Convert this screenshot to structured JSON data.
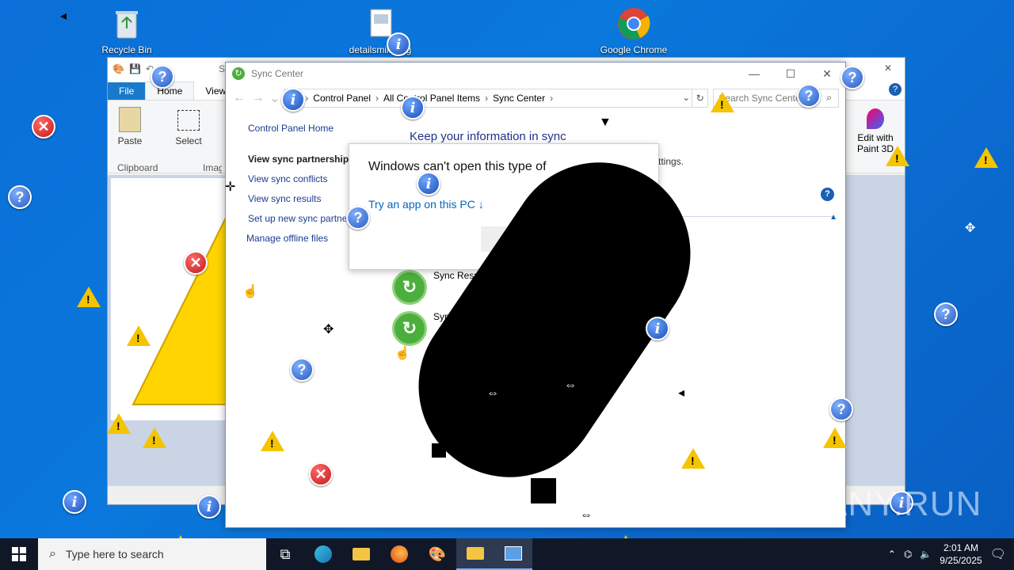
{
  "desktop": {
    "icons": [
      {
        "name": "recycle-bin",
        "label": "Recycle Bin"
      },
      {
        "name": "details",
        "label": "detailsmilla.jpg"
      },
      {
        "name": "chrome",
        "label": "Google Chrome"
      }
    ]
  },
  "paint": {
    "quick_save_title": "Sec",
    "tabs": [
      "File",
      "Home",
      "View"
    ],
    "groups": {
      "clipboard": "Clipboard",
      "paste": "Paste",
      "image": "Image",
      "select": "Select"
    },
    "edit_3d": "Edit with Paint 3D"
  },
  "sync_center": {
    "title": "Sync Center",
    "breadcrumb": [
      "Control Panel",
      "All Control Panel Items",
      "Sync Center"
    ],
    "search_placeholder": "Search Sync Center",
    "nav": {
      "home": "Control Panel Home",
      "items": [
        "View sync partnerships",
        "View sync conflicts",
        "View sync results",
        "Set up new sync partnerships",
        "Manage offline files"
      ]
    },
    "heading": "Keep your information in sync",
    "subtext_tail": "ttings.",
    "items": [
      {
        "label": "Sync Results"
      },
      {
        "label": "Sync"
      }
    ]
  },
  "popup": {
    "message": "Windows can't open this type of",
    "link": "Try an app on this PC ↓"
  },
  "taskbar": {
    "search_placeholder": "Type here to search",
    "time": "2:01 AM",
    "date": "9/25/2025"
  },
  "watermark": "ANY.RUN",
  "colors": {
    "desktop": "#0a6fd8",
    "link": "#1a3c8f",
    "heading": "#1e3287",
    "accent": "#1979ca"
  }
}
